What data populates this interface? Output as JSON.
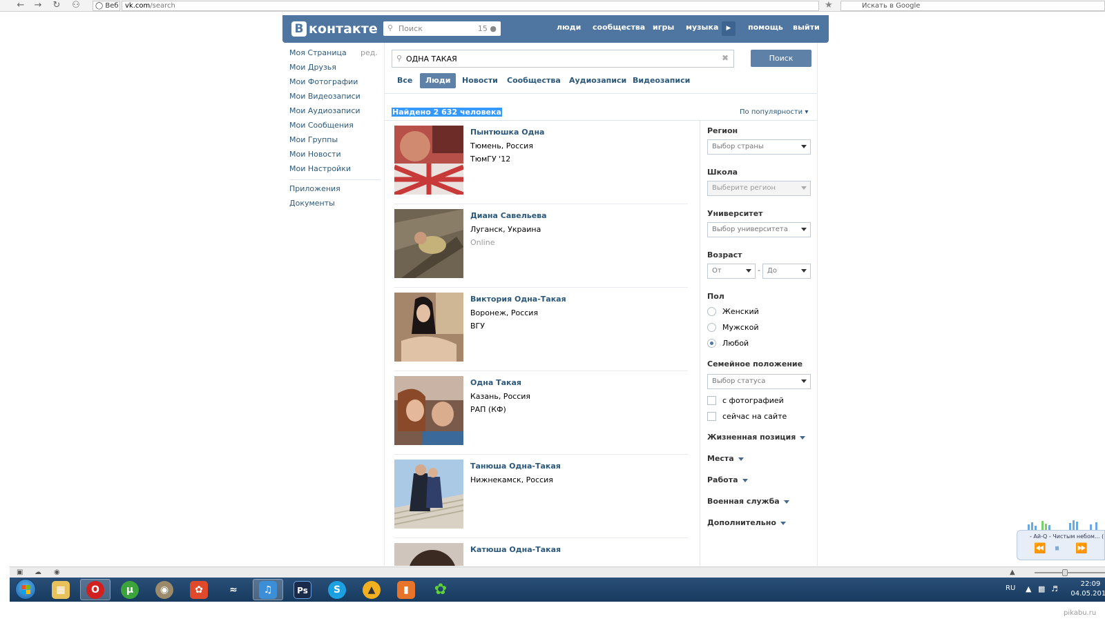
{
  "browser": {
    "site_label": "Веб",
    "url_host": "vk.com",
    "url_path": "/search",
    "search_engine_placeholder": "Искать в Google"
  },
  "header": {
    "logo_letter": "В",
    "logo_text": "контакте",
    "search_placeholder": "Поиск",
    "search_count": "15",
    "nav": [
      "люди",
      "сообщества",
      "игры",
      "музыка",
      "помощь",
      "выйти"
    ]
  },
  "left_menu": {
    "edit_label": "ред.",
    "items": [
      "Моя Страница",
      "Мои Друзья",
      "Мои Фотографии",
      "Мои Видеозаписи",
      "Мои Аудиозаписи",
      "Мои Сообщения",
      "Мои Группы",
      "Мои Новости",
      "Мои Настройки"
    ],
    "extra": [
      "Приложения",
      "Документы"
    ]
  },
  "search": {
    "query": "ОДНА ТАКАЯ",
    "button": "Поиск",
    "tabs": [
      "Все",
      "Люди",
      "Новости",
      "Сообщества",
      "Аудиозаписи",
      "Видеозаписи"
    ],
    "active_tab": "Люди",
    "found": "Найдено 2 632 человека",
    "sort": "По популярности"
  },
  "results": [
    {
      "name": "Пынтюшка Одна",
      "line1": "Тюмень, Россия",
      "line2": "ТюмГУ '12"
    },
    {
      "name": "Диана Савельева",
      "line1": "Луганск, Украина",
      "line2": "Online"
    },
    {
      "name": "Виктория Одна-Такая",
      "line1": "Воронеж, Россия",
      "line2": "ВГУ"
    },
    {
      "name": "Одна Такая",
      "line1": "Казань, Россия",
      "line2": "РАП (КФ)"
    },
    {
      "name": "Танюша Одна-Такая",
      "line1": "Нижнекамск, Россия",
      "line2": ""
    },
    {
      "name": "Катюша Одна-Такая",
      "line1": "",
      "line2": ""
    }
  ],
  "filters": {
    "region_label": "Регион",
    "region_select": "Выбор страны",
    "school_label": "Школа",
    "school_select": "Выберите регион",
    "university_label": "Университет",
    "university_select": "Выбор университета",
    "age_label": "Возраст",
    "age_from": "От",
    "age_sep": "-",
    "age_to": "До",
    "sex_label": "Пол",
    "sex_options": [
      "Женский",
      "Мужской",
      "Любой"
    ],
    "sex_selected": "Любой",
    "marital_label": "Семейное положение",
    "marital_select": "Выбор статуса",
    "checkboxes": [
      "с фотографией",
      "сейчас на сайте"
    ],
    "expanders": [
      "Жизненная позиция",
      "Места",
      "Работа",
      "Военная служба",
      "Дополнительно"
    ]
  },
  "player": {
    "title": "- Ай-Q - Чистым небом... ("
  },
  "taskbar": {
    "language": "RU",
    "time": "22:09",
    "date": "04.05.2013"
  },
  "watermark": "pikabu.ru"
}
